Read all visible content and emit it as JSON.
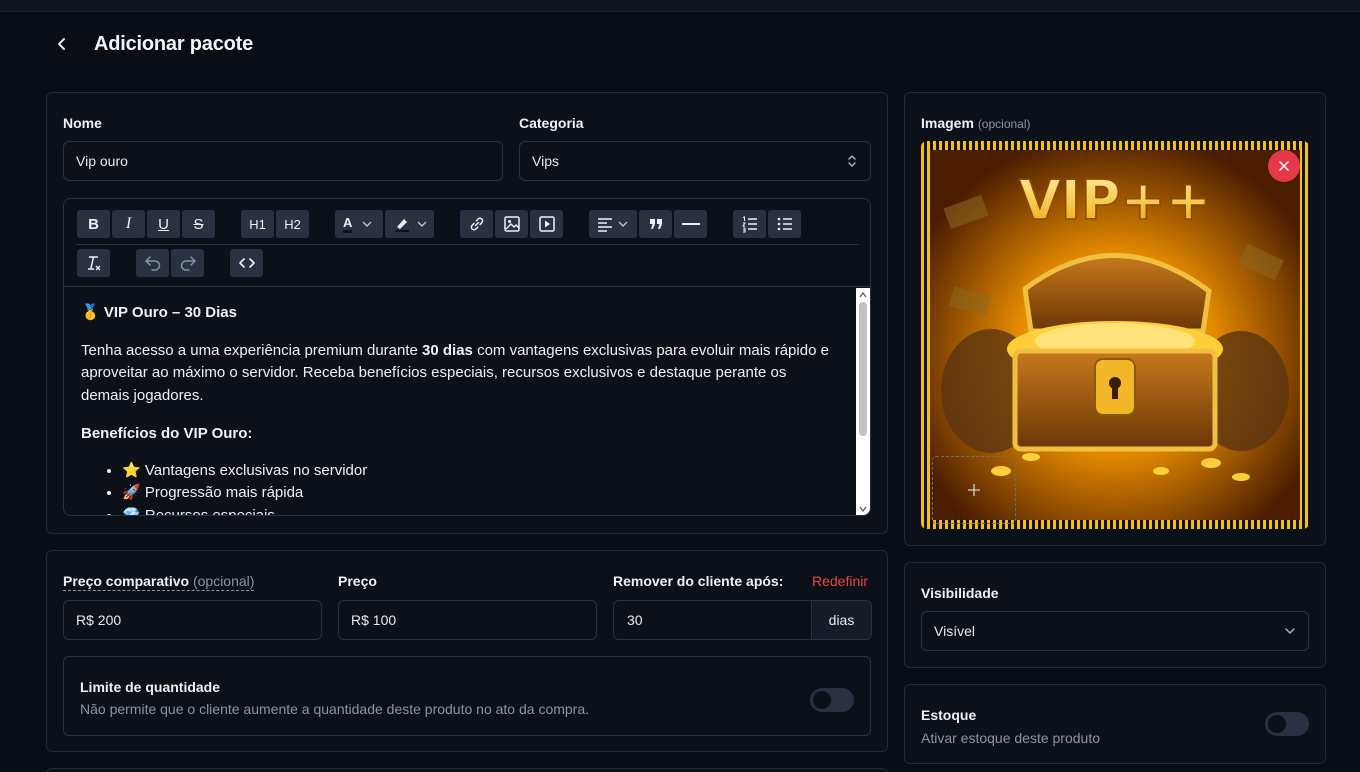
{
  "header": {
    "title": "Adicionar pacote"
  },
  "form": {
    "name_label": "Nome",
    "name_value": "Vip ouro",
    "category_label": "Categoria",
    "category_value": "Vips"
  },
  "editor": {
    "toolbar": {
      "bold": "B",
      "italic": "I",
      "underline": "U",
      "strike": "S",
      "h1": "H1",
      "h2": "H2",
      "text_color": "A"
    },
    "content": {
      "heading_emoji": "🥇",
      "heading": "VIP Ouro – 30 Dias",
      "p1_before": "Tenha acesso a uma experiência premium durante ",
      "p1_bold": "30 dias",
      "p1_after": " com vantagens exclusivas para evoluir mais rápido e aproveitar ao máximo o servidor. Receba benefícios especiais, recursos exclusivos e destaque perante os demais jogadores.",
      "benefits_title": "Benefícios do VIP Ouro:",
      "benefits": [
        {
          "emoji": "⭐",
          "text": "Vantagens exclusivas no servidor"
        },
        {
          "emoji": "🚀",
          "text": "Progressão mais rápida"
        },
        {
          "emoji": "💎",
          "text": "Recursos especiais"
        }
      ]
    }
  },
  "pricing": {
    "compare_label": "Preço comparativo",
    "compare_optional": "(opcional)",
    "compare_value": "R$ 200",
    "price_label": "Preço",
    "price_value": "R$ 100",
    "remove_label": "Remover do cliente após:",
    "reset_label": "Redefinir",
    "remove_value": "30",
    "remove_unit": "dias"
  },
  "quantity_limit": {
    "title": "Limite de quantidade",
    "description": "Não permite que o cliente aumente a quantidade deste produto no ato da compra.",
    "enabled": false
  },
  "image": {
    "label": "Imagem",
    "optional": "(opcional)",
    "banner_text": "VIP++"
  },
  "visibility": {
    "label": "Visibilidade",
    "value": "Visível"
  },
  "stock": {
    "title": "Estoque",
    "description": "Ativar estoque deste produto",
    "enabled": false
  },
  "colors": {
    "background": "#090d15",
    "card": "#0b1019",
    "border": "#222a37",
    "accent_red": "#e5394a",
    "gold": "#f5b800"
  }
}
